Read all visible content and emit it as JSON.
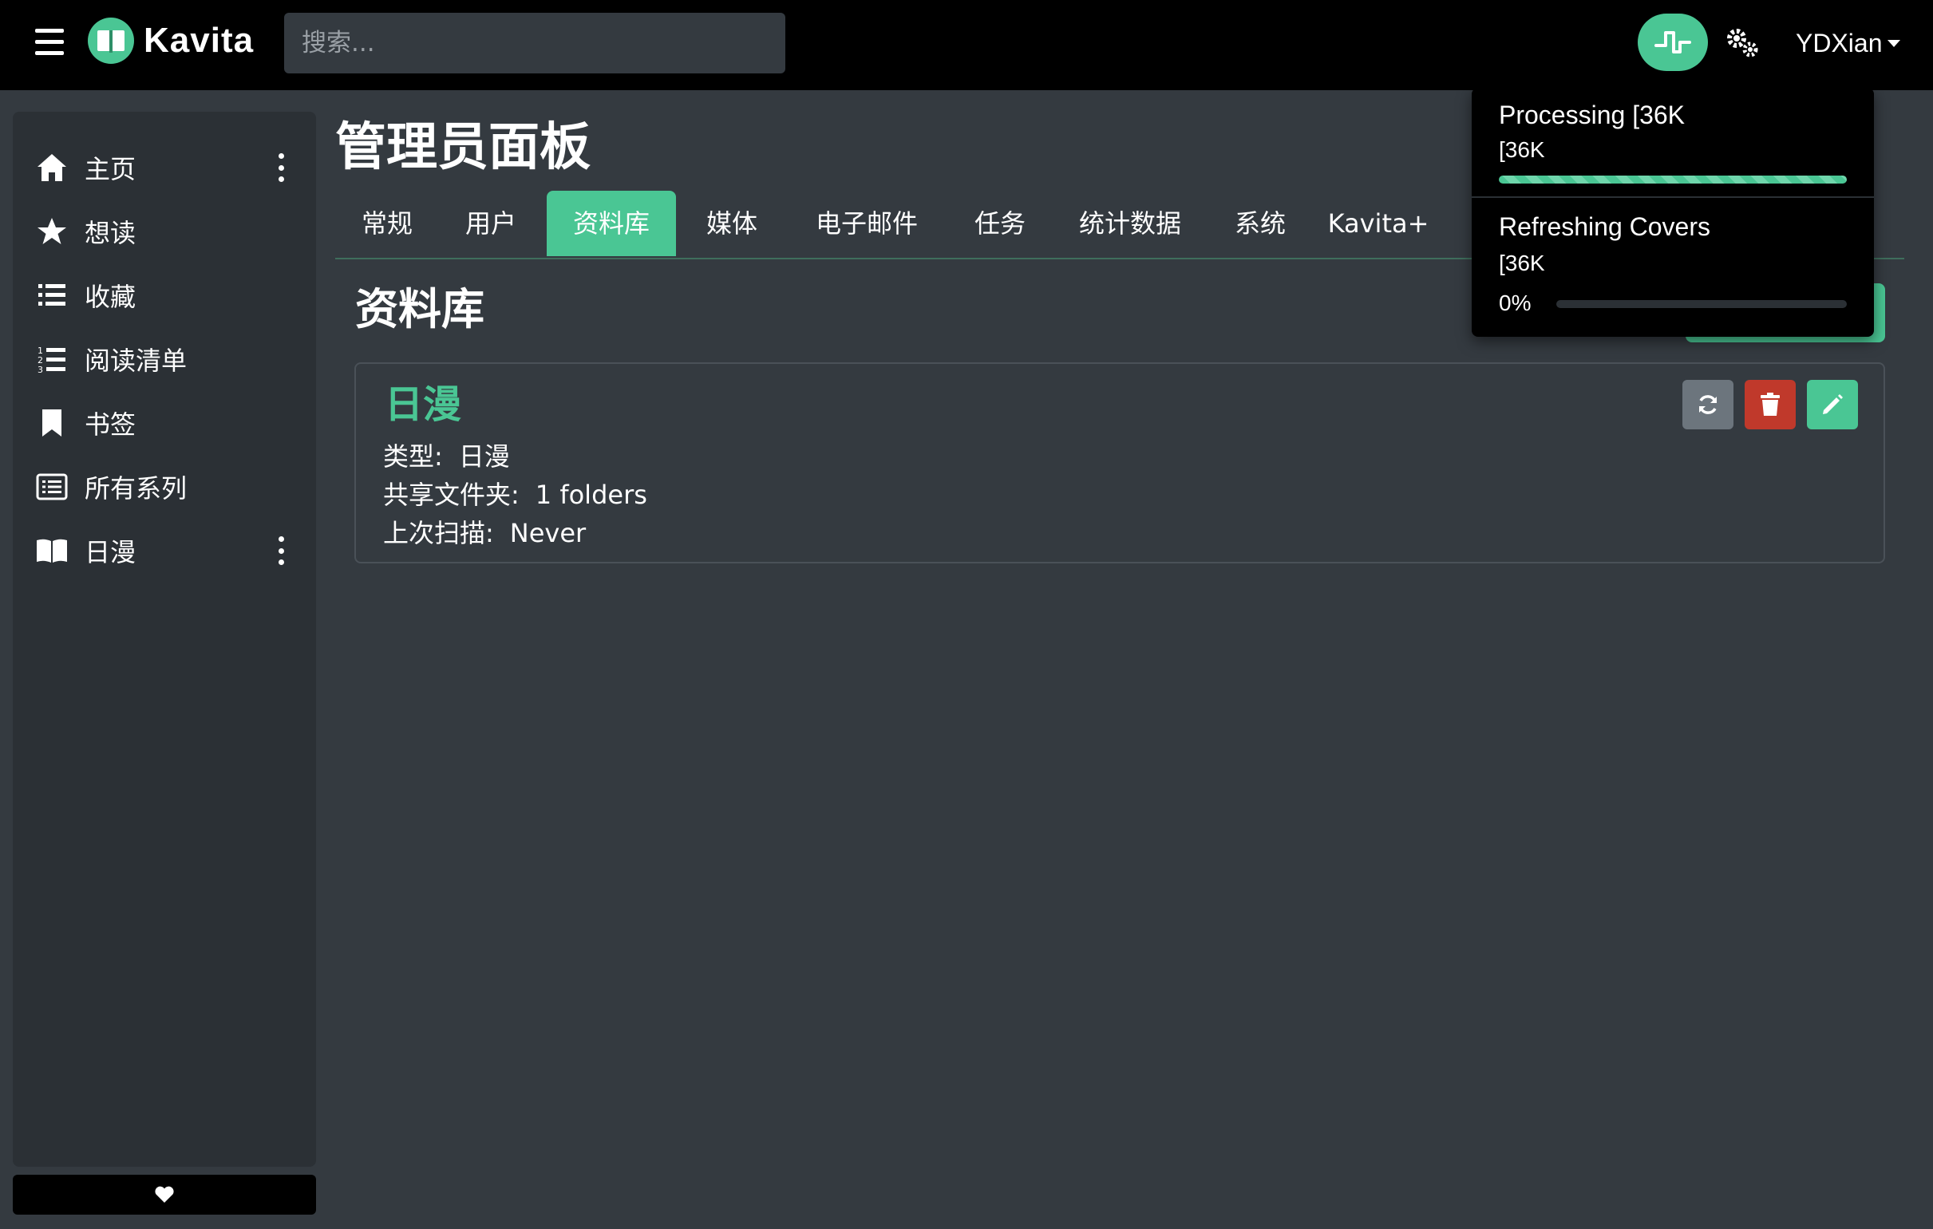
{
  "navbar": {
    "brand": "Kavita",
    "search_placeholder": "搜索...",
    "user_name": "YDXian"
  },
  "sidebar": {
    "items": [
      {
        "label": "主页",
        "icon": "home-icon",
        "has_menu": true
      },
      {
        "label": "想读",
        "icon": "star-icon",
        "has_menu": false
      },
      {
        "label": "收藏",
        "icon": "list-icon",
        "has_menu": false
      },
      {
        "label": "阅读清单",
        "icon": "ordered-list-icon",
        "has_menu": false
      },
      {
        "label": "书签",
        "icon": "bookmark-icon",
        "has_menu": false
      },
      {
        "label": "所有系列",
        "icon": "list-alt-icon",
        "has_menu": false
      },
      {
        "label": "日漫",
        "icon": "book-open-icon",
        "has_menu": true
      }
    ]
  },
  "main": {
    "title": "管理员面板",
    "tabs": [
      {
        "label": "常规"
      },
      {
        "label": "用户"
      },
      {
        "label": "资料库",
        "active": true
      },
      {
        "label": "媒体"
      },
      {
        "label": "电子邮件"
      },
      {
        "label": "任务"
      },
      {
        "label": "统计数据"
      },
      {
        "label": "系统"
      },
      {
        "label": "Kavita+"
      }
    ],
    "section_title": "资料库",
    "library": {
      "name": "日漫",
      "type_key": "类型:",
      "type_value": "日漫",
      "folders_key": "共享文件夹:",
      "folders_value": "1 folders",
      "scan_key": "上次扫描:",
      "scan_value": "Never"
    }
  },
  "activity": {
    "items": [
      {
        "title": "Processing [36K",
        "subtitle": "[36K",
        "progress": 1.0,
        "indeterminate": true
      },
      {
        "title": "Refreshing Covers",
        "subtitle": "[36K",
        "percent_label": "0%",
        "progress": 0.0
      }
    ]
  },
  "colors": {
    "accent": "#4ac694",
    "danger": "#c0392b",
    "secondary": "#6c757d",
    "navbar": "#000000",
    "page_bg": "#343a40",
    "sidebar_bg": "#2b3035"
  }
}
